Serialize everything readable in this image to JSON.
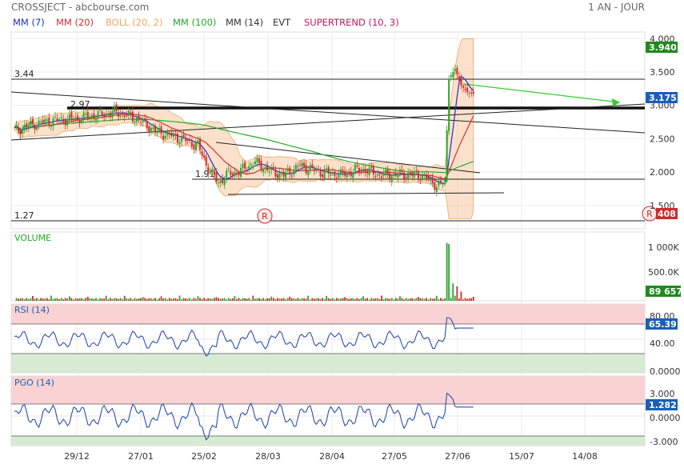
{
  "header": {
    "title": "CROSSJECT - abcbourse.com",
    "period": "1 AN - JOUR"
  },
  "indicators": [
    {
      "label": "MM (7)",
      "color": "#1a33c8"
    },
    {
      "label": "MM (20)",
      "color": "#d32f2f"
    },
    {
      "label": "BOLL (20, 2)",
      "color": "#f0a860"
    },
    {
      "label": "MM (100)",
      "color": "#22aa22"
    },
    {
      "label": "MM (14)",
      "color": "#333333"
    },
    {
      "label": "EVT",
      "color": "#333333"
    },
    {
      "label": "SUPERTREND (10, 3)",
      "color": "#c2185b"
    }
  ],
  "levels": [
    {
      "label": "3.44",
      "value": 3.44
    },
    {
      "label": "2.97",
      "value": 2.97
    },
    {
      "label": "1.91",
      "value": 1.91
    },
    {
      "label": "1.27",
      "value": 1.27
    }
  ],
  "badges": {
    "high": "3.940",
    "last": "3.175",
    "low": "408",
    "volume": "89 657",
    "rsi": "65.39",
    "pgo": "1.282"
  },
  "panels": {
    "volume": "VOLUME",
    "rsi": "RSI (14)",
    "pgo": "PGO (14)"
  },
  "marker": "R",
  "colors": {
    "grid": "#e6e6e6",
    "green_badge": "#1e8a1e",
    "blue_badge": "#1a5fb4",
    "red_badge": "#cc2b2b",
    "up_candle": "#2aa62a",
    "down_candle": "#d12b2b",
    "line_blue": "#2b4fb0"
  },
  "chart_data": [
    {
      "type": "candlestick",
      "title": "",
      "ylim": [
        1.27,
        4.0
      ],
      "y_ticks": [
        "4.000",
        "3.500",
        "3.000",
        "2.500",
        "2.000",
        "1.500"
      ],
      "x_ticks": [
        "29/12",
        "27/01",
        "25/02",
        "28/03",
        "28/04",
        "27/05",
        "27/06",
        "15/07",
        "14/08"
      ],
      "close_path": [
        [
          0,
          2.62
        ],
        [
          10,
          2.72
        ],
        [
          20,
          2.78
        ],
        [
          30,
          2.8
        ],
        [
          40,
          2.85
        ],
        [
          50,
          2.9
        ],
        [
          60,
          2.8
        ],
        [
          70,
          2.6
        ],
        [
          80,
          2.52
        ],
        [
          90,
          2.4
        ],
        [
          95,
          2.05
        ],
        [
          100,
          1.84
        ],
        [
          105,
          1.98
        ],
        [
          110,
          2.0
        ],
        [
          118,
          2.15
        ],
        [
          125,
          2.02
        ],
        [
          132,
          1.95
        ],
        [
          140,
          2.1
        ],
        [
          150,
          2.0
        ],
        [
          160,
          1.96
        ],
        [
          170,
          2.05
        ],
        [
          180,
          1.95
        ],
        [
          190,
          1.97
        ],
        [
          200,
          1.95
        ],
        [
          207,
          1.8
        ],
        [
          211,
          1.85
        ],
        [
          213,
          3.4
        ],
        [
          216,
          3.55
        ],
        [
          219,
          3.3
        ],
        [
          222,
          3.2
        ],
        [
          225,
          3.175
        ]
      ],
      "last": 3.175,
      "high": 3.94
    },
    {
      "type": "bar",
      "title": "VOLUME",
      "y_ticks": [
        "1 000K",
        "500.0K"
      ],
      "last": 89657,
      "spike_values": [
        1000000,
        980000,
        300000,
        250000,
        160000
      ]
    },
    {
      "type": "line",
      "title": "RSI (14)",
      "y_ticks": [
        "80.00",
        "40.00",
        "0.0000"
      ],
      "ylim": [
        0,
        100
      ],
      "zones": [
        30,
        70
      ],
      "last": 65.39,
      "values_tail": [
        48,
        55,
        80,
        78,
        64,
        65.39
      ]
    },
    {
      "type": "line",
      "title": "PGO (14)",
      "y_ticks": [
        "3.000",
        "0.0000",
        "-3.000"
      ],
      "ylim": [
        -3.5,
        4.5
      ],
      "zones": [
        -3,
        2
      ],
      "last": 1.282,
      "values_tail": [
        0.2,
        0.5,
        3.3,
        3.0,
        1.5,
        1.282
      ]
    }
  ]
}
